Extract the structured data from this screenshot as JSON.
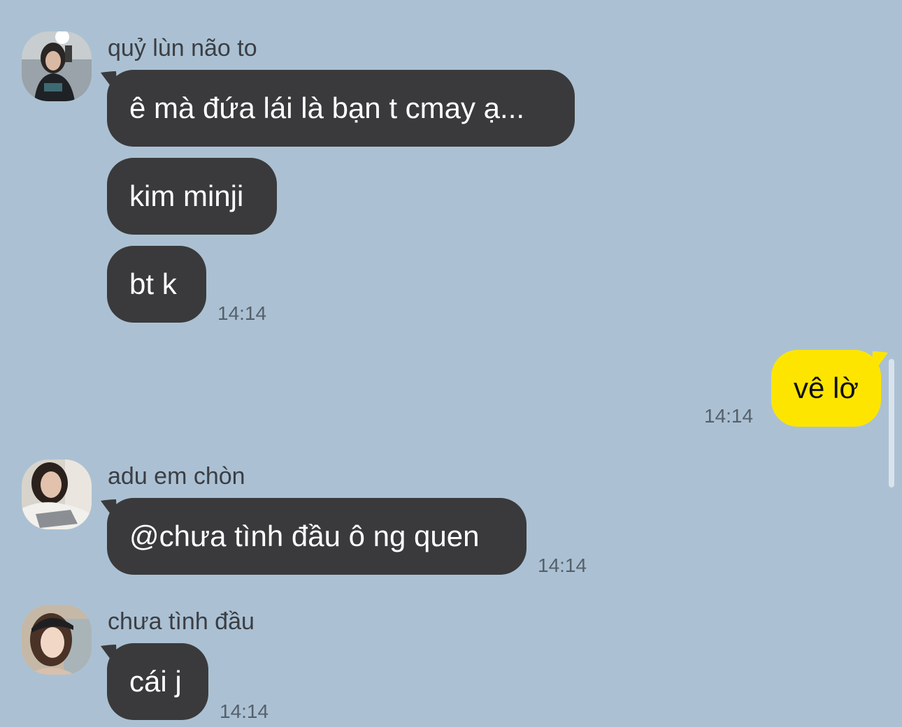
{
  "chat": {
    "groups": [
      {
        "sender": "quỷ lùn não to",
        "avatar_icon": "profile-photo-mirror-selfie",
        "messages": [
          "ê mà đứa lái là bạn t cmay ạ...",
          "kim minji",
          "bt k"
        ],
        "time": "14:14"
      },
      {
        "sender": "me",
        "messages": [
          "vê lờ"
        ],
        "time": "14:14"
      },
      {
        "sender": "adu em chòn",
        "avatar_icon": "profile-photo-girl",
        "messages": [
          "@chưa tình đầu ô ng quen"
        ],
        "time": "14:14"
      },
      {
        "sender": "chưa tình đầu",
        "avatar_icon": "profile-photo-cap",
        "messages": [
          "cái j"
        ],
        "time": "14:14"
      }
    ]
  },
  "colors": {
    "background": "#abc1d3",
    "incoming_bubble": "#3a3a3c",
    "outgoing_bubble": "#fee500"
  }
}
